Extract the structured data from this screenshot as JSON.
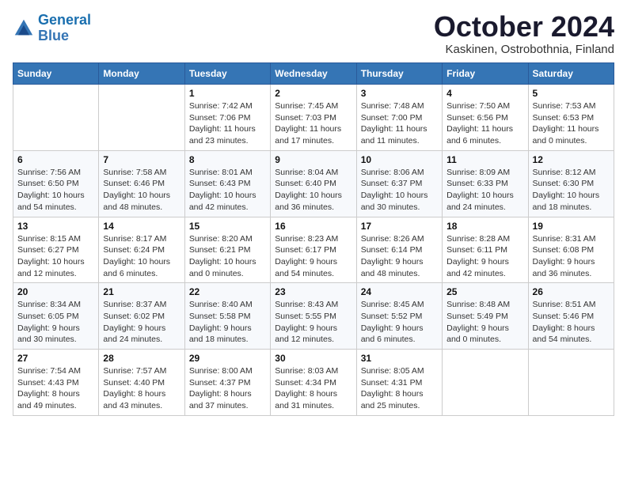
{
  "header": {
    "logo_line1": "General",
    "logo_line2": "Blue",
    "month_title": "October 2024",
    "location": "Kaskinen, Ostrobothnia, Finland"
  },
  "weekdays": [
    "Sunday",
    "Monday",
    "Tuesday",
    "Wednesday",
    "Thursday",
    "Friday",
    "Saturday"
  ],
  "weeks": [
    [
      {
        "day": "",
        "info": ""
      },
      {
        "day": "",
        "info": ""
      },
      {
        "day": "1",
        "info": "Sunrise: 7:42 AM\nSunset: 7:06 PM\nDaylight: 11 hours\nand 23 minutes."
      },
      {
        "day": "2",
        "info": "Sunrise: 7:45 AM\nSunset: 7:03 PM\nDaylight: 11 hours\nand 17 minutes."
      },
      {
        "day": "3",
        "info": "Sunrise: 7:48 AM\nSunset: 7:00 PM\nDaylight: 11 hours\nand 11 minutes."
      },
      {
        "day": "4",
        "info": "Sunrise: 7:50 AM\nSunset: 6:56 PM\nDaylight: 11 hours\nand 6 minutes."
      },
      {
        "day": "5",
        "info": "Sunrise: 7:53 AM\nSunset: 6:53 PM\nDaylight: 11 hours\nand 0 minutes."
      }
    ],
    [
      {
        "day": "6",
        "info": "Sunrise: 7:56 AM\nSunset: 6:50 PM\nDaylight: 10 hours\nand 54 minutes."
      },
      {
        "day": "7",
        "info": "Sunrise: 7:58 AM\nSunset: 6:46 PM\nDaylight: 10 hours\nand 48 minutes."
      },
      {
        "day": "8",
        "info": "Sunrise: 8:01 AM\nSunset: 6:43 PM\nDaylight: 10 hours\nand 42 minutes."
      },
      {
        "day": "9",
        "info": "Sunrise: 8:04 AM\nSunset: 6:40 PM\nDaylight: 10 hours\nand 36 minutes."
      },
      {
        "day": "10",
        "info": "Sunrise: 8:06 AM\nSunset: 6:37 PM\nDaylight: 10 hours\nand 30 minutes."
      },
      {
        "day": "11",
        "info": "Sunrise: 8:09 AM\nSunset: 6:33 PM\nDaylight: 10 hours\nand 24 minutes."
      },
      {
        "day": "12",
        "info": "Sunrise: 8:12 AM\nSunset: 6:30 PM\nDaylight: 10 hours\nand 18 minutes."
      }
    ],
    [
      {
        "day": "13",
        "info": "Sunrise: 8:15 AM\nSunset: 6:27 PM\nDaylight: 10 hours\nand 12 minutes."
      },
      {
        "day": "14",
        "info": "Sunrise: 8:17 AM\nSunset: 6:24 PM\nDaylight: 10 hours\nand 6 minutes."
      },
      {
        "day": "15",
        "info": "Sunrise: 8:20 AM\nSunset: 6:21 PM\nDaylight: 10 hours\nand 0 minutes."
      },
      {
        "day": "16",
        "info": "Sunrise: 8:23 AM\nSunset: 6:17 PM\nDaylight: 9 hours\nand 54 minutes."
      },
      {
        "day": "17",
        "info": "Sunrise: 8:26 AM\nSunset: 6:14 PM\nDaylight: 9 hours\nand 48 minutes."
      },
      {
        "day": "18",
        "info": "Sunrise: 8:28 AM\nSunset: 6:11 PM\nDaylight: 9 hours\nand 42 minutes."
      },
      {
        "day": "19",
        "info": "Sunrise: 8:31 AM\nSunset: 6:08 PM\nDaylight: 9 hours\nand 36 minutes."
      }
    ],
    [
      {
        "day": "20",
        "info": "Sunrise: 8:34 AM\nSunset: 6:05 PM\nDaylight: 9 hours\nand 30 minutes."
      },
      {
        "day": "21",
        "info": "Sunrise: 8:37 AM\nSunset: 6:02 PM\nDaylight: 9 hours\nand 24 minutes."
      },
      {
        "day": "22",
        "info": "Sunrise: 8:40 AM\nSunset: 5:58 PM\nDaylight: 9 hours\nand 18 minutes."
      },
      {
        "day": "23",
        "info": "Sunrise: 8:43 AM\nSunset: 5:55 PM\nDaylight: 9 hours\nand 12 minutes."
      },
      {
        "day": "24",
        "info": "Sunrise: 8:45 AM\nSunset: 5:52 PM\nDaylight: 9 hours\nand 6 minutes."
      },
      {
        "day": "25",
        "info": "Sunrise: 8:48 AM\nSunset: 5:49 PM\nDaylight: 9 hours\nand 0 minutes."
      },
      {
        "day": "26",
        "info": "Sunrise: 8:51 AM\nSunset: 5:46 PM\nDaylight: 8 hours\nand 54 minutes."
      }
    ],
    [
      {
        "day": "27",
        "info": "Sunrise: 7:54 AM\nSunset: 4:43 PM\nDaylight: 8 hours\nand 49 minutes."
      },
      {
        "day": "28",
        "info": "Sunrise: 7:57 AM\nSunset: 4:40 PM\nDaylight: 8 hours\nand 43 minutes."
      },
      {
        "day": "29",
        "info": "Sunrise: 8:00 AM\nSunset: 4:37 PM\nDaylight: 8 hours\nand 37 minutes."
      },
      {
        "day": "30",
        "info": "Sunrise: 8:03 AM\nSunset: 4:34 PM\nDaylight: 8 hours\nand 31 minutes."
      },
      {
        "day": "31",
        "info": "Sunrise: 8:05 AM\nSunset: 4:31 PM\nDaylight: 8 hours\nand 25 minutes."
      },
      {
        "day": "",
        "info": ""
      },
      {
        "day": "",
        "info": ""
      }
    ]
  ]
}
